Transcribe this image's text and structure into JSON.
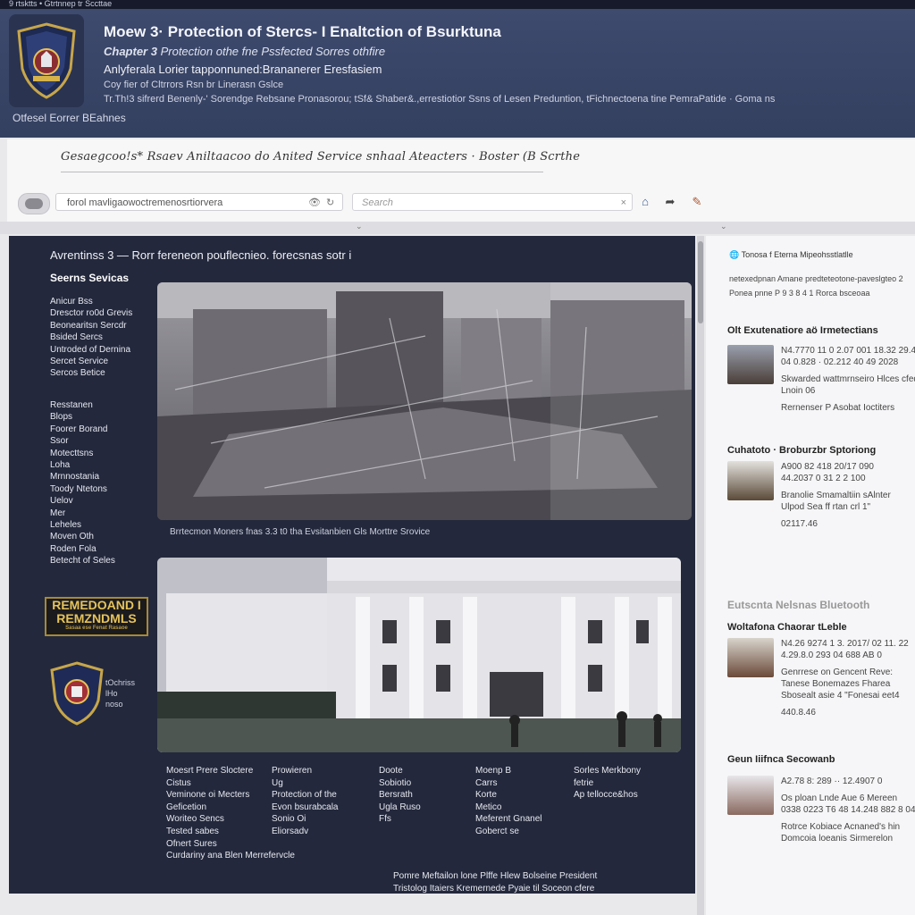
{
  "top_strip": "9 rtsktts • Gtrtnnep tr Sccttae",
  "header": {
    "title": "Moew 3· Protection of Stercs- I Enaltction of Bsurktuna",
    "chapter_label": "Chapter 3",
    "chapter_text": "Protection othe fne Pssfected Sorres othfire",
    "subtitle": "Anlyferala Lorier tapponnuned:Brananerer Eresfasiem",
    "line1": "Coy fier of Cltrrors Rsn br Linerasn Gslce",
    "line2": "Tr.Th!3 sifrerd Benenly-' Sorendge Rebsane Pronasorou; tSf& Shaber&.,errestiotior Ssns of Lesen Preduntion, tFichnectoena tine PemraPatide · Goma ns",
    "org": "Otfesel Eorrer BEahnes"
  },
  "browser": {
    "brand": "Gesaegcoo!s* Rsaev Aniltaacoo do Anited Service snhaal Ateacters · Boster (B Scrthe",
    "url": "forol mavligaowoctremenosrtiorvera",
    "search_placeholder": "Search",
    "icons": [
      "home-icon",
      "share-icon",
      "bookmark-icon"
    ]
  },
  "main": {
    "title": "Avrentinss 3 — Rorr fereneon pouflecnieo. forecsnas sotr i",
    "sidebar_heading": "Seerns Sevicas",
    "sidebar_group1": [
      "Anicur Bss",
      "Dresctor ro0d Grevis",
      "Beonearitsn Sercdr",
      "Bsided Sercs",
      "Untroded of Dernina",
      "Sercet Service",
      "Sercos Betice"
    ],
    "sidebar_group2": [
      "Resstanen",
      "Blops",
      "Foorer Borand",
      "Ssor",
      "Motecttsns",
      "Loha",
      "Mrnnostania",
      "Toody Ntetons",
      "Uelov",
      "Mer",
      "Leheles",
      "Moven Oth",
      "Roden Fola",
      "Betecht of Seles"
    ],
    "photo1_caption": "Brrtecmon Moners fnas 3.3 t0 tha Evsitanbien Gls Morttre Srovice",
    "badge_text": "REMEDOAND I REMZNDMLS",
    "badge_small": "Sasaa ese Fenat Rasaoe",
    "seal_text": [
      "tOchriss",
      "lHo",
      "noso"
    ],
    "footer_col1": [
      "Moesrt Prere Sloctere",
      "Cistus",
      "Veminone oi Mecters",
      "Geficetion",
      "Woriteo Sencs",
      "Tested sabes",
      "Ofnert Sures",
      "Curdariny ana Blen Merrefervcle"
    ],
    "footer_col2": [
      "Prowieren",
      "Ug",
      "Protection of the",
      "Evon bsurabcala",
      "Sonio Oi",
      "",
      "Eliorsadv"
    ],
    "footer_col3": [
      "Doote",
      "Sobiotio",
      "Bersrath",
      "Ugla Ruso",
      "Ffs"
    ],
    "footer_col4": [
      "Moenp B",
      "Carrs",
      "Korte",
      "Metico",
      "Meferent Gnanel",
      "Goberct se"
    ],
    "footer_col5": [
      "Sorles Merkbony",
      "fetrie",
      "Ap tellocce&hos"
    ],
    "footer_note": [
      "Pomre Meftailon lone Plffe Hlew Bolseine President",
      "Tristolog Itaiers Kremernede Pyaie til Soceon cfere"
    ]
  },
  "right": {
    "top1": "Tonosa f Eterna Mipeohsstlatlle",
    "top2": "netexedpnan Amane predteteotone-paveslgteo 2",
    "top3": "Ponea pnne P 9 3 8 4 1 Rorca bsceoaa",
    "sections": [
      {
        "heading": "Olt Exutenatiore aö Irmetectians",
        "lines": [
          "N4.7770 11 0 2.07 001 18.32 29.4",
          "04 0.828 · 02.212 40 49 2028",
          "Skwarded wattmrnseiro Hlces cfed",
          "Lnoin 06",
          "Rernenser P Asobat Ioctiters"
        ]
      },
      {
        "heading": "Cuhatoto · Broburzbr Sptoriong",
        "lines": [
          "A900 82 418 20/17 090",
          "44.2037 0 31 2 2 100",
          "Branolie Smamaltiin sAlnter",
          "Ulpod Sea ff rtan crl 1\"",
          "02117.46"
        ]
      },
      {
        "heading": "Woltafona Chaorar tLeble",
        "lines": [
          "N4.26 9274 1 3. 2017/ 02 11. 22",
          "4.29.8.0 293 04 688 AB 0",
          "Genrrese on Gencent Reve:",
          "Tanese Bonemazes Fharea",
          "Sbosealt asie 4 \"Fonesai eet4",
          "440.8.46"
        ]
      },
      {
        "heading": "Geun Iiifnca Secowanb",
        "lines": [
          "A2.78 8: 289 ·· 12.4907 0",
          "Os ploan Lnde Aue 6 Mereen",
          "0338 0223 T6 48 14.248 882 8 04",
          "",
          "Rotrce Kobiace Acnaned's hin",
          "Domcoia loeanis Sirmerelon"
        ]
      }
    ],
    "faint_heading": "Eutscnta Nelsnas Bluetooth"
  },
  "colors": {
    "header_bg": "#3a4668",
    "main_bg": "#23283c",
    "right_bg": "#f6f6f8",
    "badge_gold": "#d6b24a"
  }
}
